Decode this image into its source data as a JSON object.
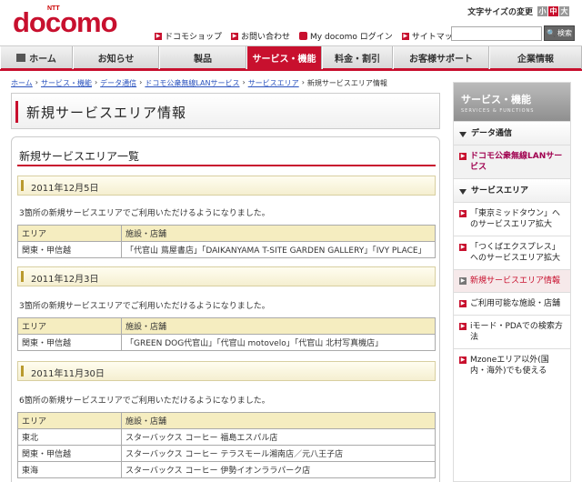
{
  "header": {
    "logo_ntt": "NTT",
    "logo_text": "docomo",
    "font_size_label": "文字サイズの変更",
    "font_size_options": [
      "小",
      "中",
      "大"
    ],
    "utility_links": [
      "ドコモショップ",
      "お問い合わせ",
      "My docomo ログイン",
      "サイトマップ"
    ],
    "search_placeholder": "",
    "search_button": "検索"
  },
  "gnav": {
    "items": [
      "ホーム",
      "お知らせ",
      "製品",
      "サービス・機能",
      "料金・割引",
      "お客様サポート",
      "企業情報"
    ],
    "active_index": 3
  },
  "breadcrumb": {
    "items": [
      "ホーム",
      "サービス・機能",
      "データ通信",
      "ドコモ公衆無線LANサービス",
      "サービスエリア",
      "新規サービスエリア情報"
    ]
  },
  "page_title": "新規サービスエリア情報",
  "content": {
    "heading": "新規サービスエリア一覧",
    "col_area": "エリア",
    "col_facility": "施設・店舗",
    "sections": [
      {
        "date": "2011年12月5日",
        "note": "3箇所の新規サービスエリアでご利用いただけるようになりました。",
        "rows": [
          [
            "関東・甲信越",
            "「代官山 蔦屋書店」「DAIKANYAMA T-SITE GARDEN GALLERY」「IVY PLACE」"
          ]
        ]
      },
      {
        "date": "2011年12月3日",
        "note": "3箇所の新規サービスエリアでご利用いただけるようになりました。",
        "rows": [
          [
            "関東・甲信越",
            "「GREEN DOG代官山」「代官山 motovelo」「代官山 北村写真機店」"
          ]
        ]
      },
      {
        "date": "2011年11月30日",
        "note": "6箇所の新規サービスエリアでご利用いただけるようになりました。",
        "rows": [
          [
            "東北",
            "スターバックス コーヒー 福島エスパル店"
          ],
          [
            "関東・甲信越",
            "スターバックス コーヒー テラスモール湘南店／元八王子店"
          ],
          [
            "東海",
            "スターバックス コーヒー 伊勢イオンララパーク店"
          ]
        ]
      }
    ]
  },
  "sidebar": {
    "title": "サービス・機能",
    "title_en": "SERVICES & FUNCTIONS",
    "items": [
      {
        "label": "データ通信",
        "kind": "cat"
      },
      {
        "label": "ドコモ公衆無線LANサービス",
        "kind": "sub-red"
      },
      {
        "label": "サービスエリア",
        "kind": "cat"
      },
      {
        "label": "「東京ミッドタウン」へのサービスエリア拡大",
        "kind": "link"
      },
      {
        "label": "「つくばエクスプレス」へのサービスエリア拡大",
        "kind": "link"
      },
      {
        "label": "新規サービスエリア情報",
        "kind": "current"
      },
      {
        "label": "ご利用可能な施設・店舗",
        "kind": "link"
      },
      {
        "label": "iモード・PDAでの検索方法",
        "kind": "link"
      },
      {
        "label": "Mzoneエリア以外(国内・海外)でも使える",
        "kind": "link"
      }
    ]
  },
  "colors": {
    "brand": "#c8102e",
    "table_header": "#f5edc0"
  }
}
